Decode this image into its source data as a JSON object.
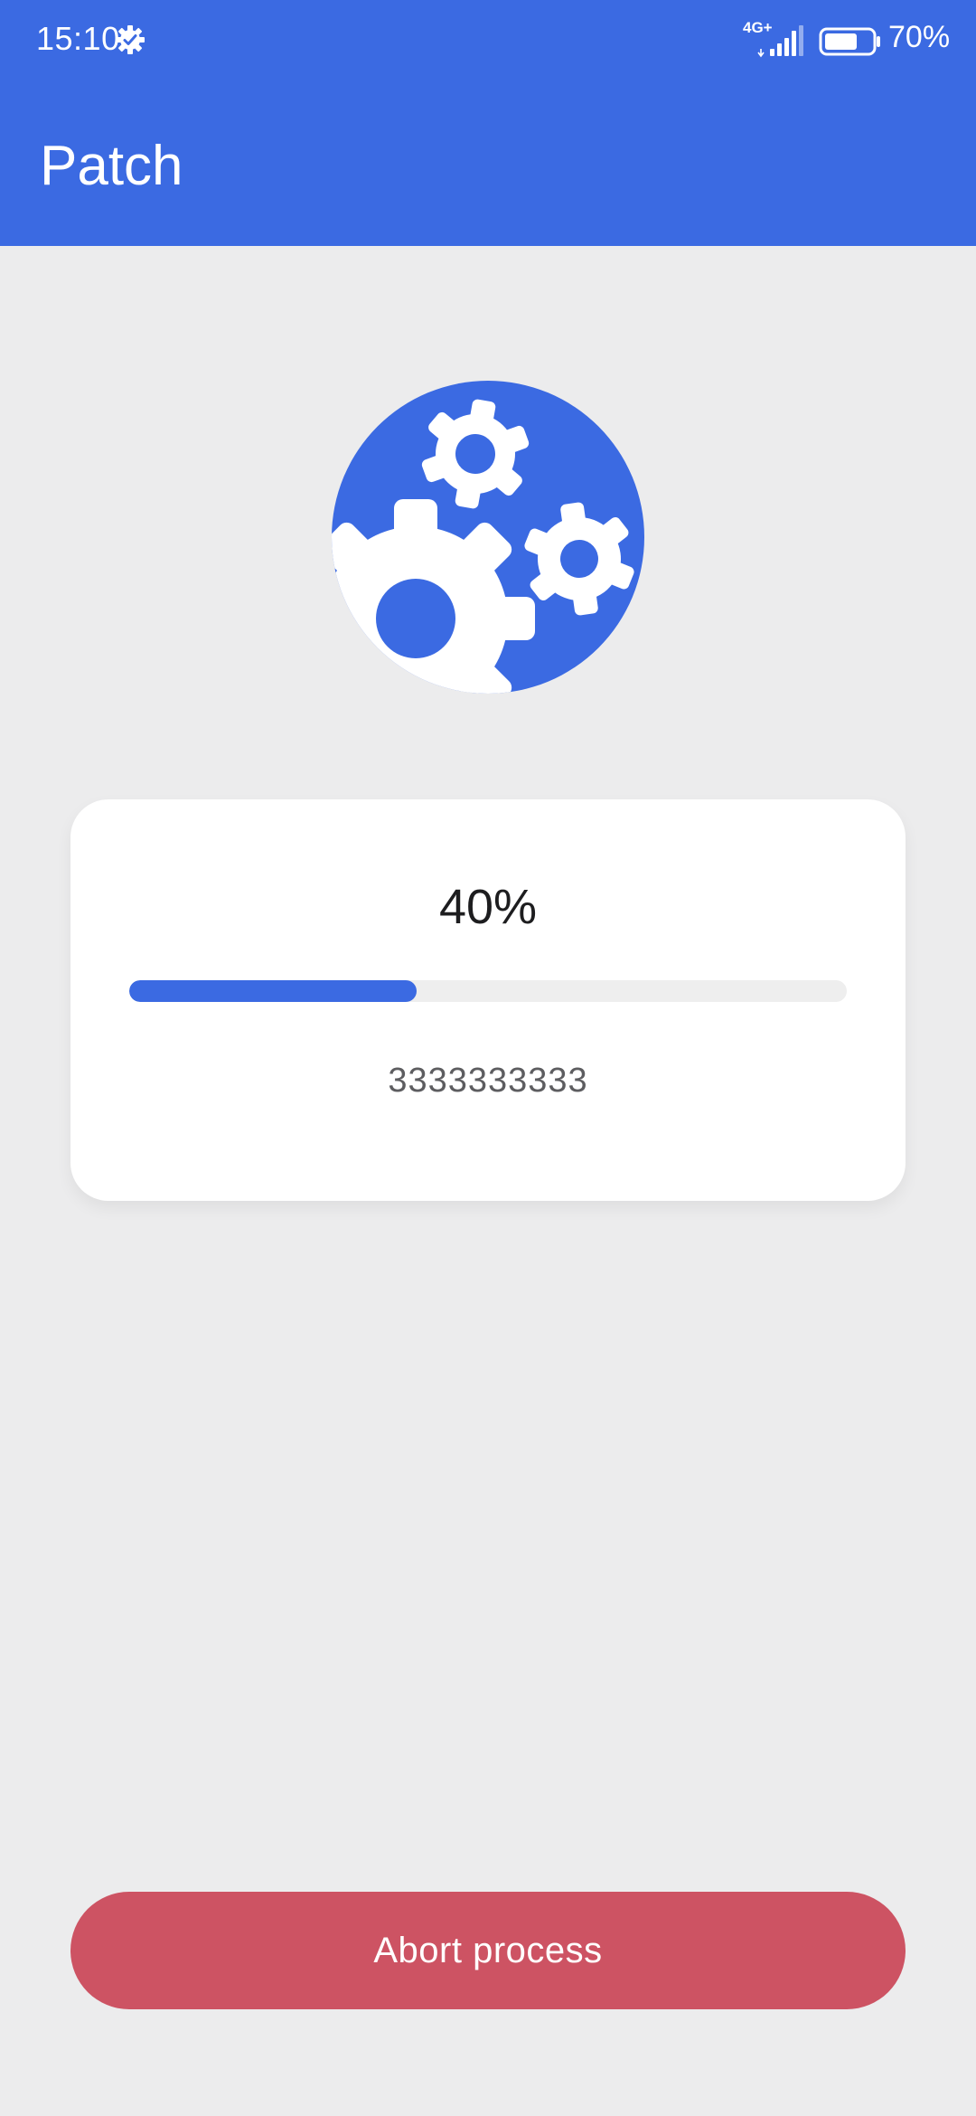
{
  "status_bar": {
    "time": "15:10",
    "network": "4G+",
    "battery_percent": "70%",
    "battery_level": 0.7
  },
  "header": {
    "title": "Patch"
  },
  "progress": {
    "percent_label": "40%",
    "value": 0.4,
    "status": "3333333333"
  },
  "actions": {
    "abort_label": "Abort process"
  },
  "colors": {
    "primary": "#3b6ae2",
    "danger": "#cd5363",
    "background": "#ececed"
  },
  "icons": {
    "hero": "gears-icon",
    "status": "settings-gear-icon"
  }
}
